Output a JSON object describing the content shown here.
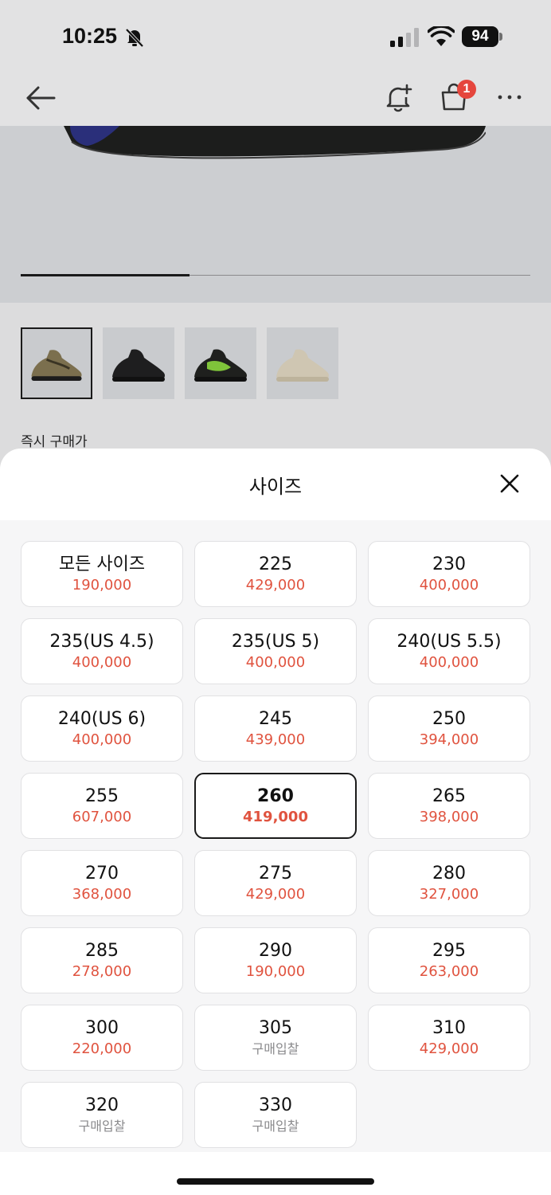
{
  "status_bar": {
    "time": "10:25",
    "battery": "94"
  },
  "nav": {
    "cart_count": "1"
  },
  "product": {
    "instant_buy_label": "즉시 구매가",
    "thumbnails": [
      "tan",
      "black",
      "green",
      "cream"
    ]
  },
  "sheet": {
    "title": "사이즈",
    "sizes": [
      {
        "label": "모든 사이즈",
        "price": "190,000"
      },
      {
        "label": "225",
        "price": "429,000"
      },
      {
        "label": "230",
        "price": "400,000"
      },
      {
        "label": "235(US 4.5)",
        "price": "400,000"
      },
      {
        "label": "235(US 5)",
        "price": "400,000"
      },
      {
        "label": "240(US 5.5)",
        "price": "400,000"
      },
      {
        "label": "240(US 6)",
        "price": "400,000"
      },
      {
        "label": "245",
        "price": "439,000"
      },
      {
        "label": "250",
        "price": "394,000"
      },
      {
        "label": "255",
        "price": "607,000"
      },
      {
        "label": "260",
        "price": "419,000"
      },
      {
        "label": "265",
        "price": "398,000"
      },
      {
        "label": "270",
        "price": "368,000"
      },
      {
        "label": "275",
        "price": "429,000"
      },
      {
        "label": "280",
        "price": "327,000"
      },
      {
        "label": "285",
        "price": "278,000"
      },
      {
        "label": "290",
        "price": "190,000"
      },
      {
        "label": "295",
        "price": "263,000"
      },
      {
        "label": "300",
        "price": "220,000"
      },
      {
        "label": "305",
        "price": "구매입찰"
      },
      {
        "label": "310",
        "price": "429,000"
      },
      {
        "label": "320",
        "price": "구매입찰"
      },
      {
        "label": "330",
        "price": "구매입찰"
      }
    ],
    "selected_size": "260"
  },
  "colors": {
    "price_red": "#e0533f",
    "badge_red": "#e5463d",
    "bid_gray": "#8a8a8c"
  }
}
